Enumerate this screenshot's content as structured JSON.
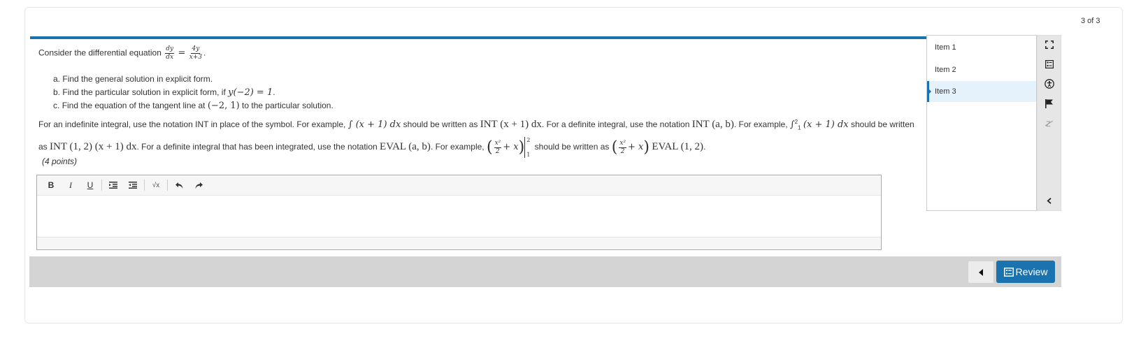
{
  "header": {
    "counter": "3 of 3"
  },
  "question": {
    "intro_text": "Consider the differential equation",
    "equation": {
      "lhs_num": "dy",
      "lhs_den": "dx",
      "eq": "=",
      "rhs_num": "4y",
      "rhs_den": "x+3",
      "end": "."
    },
    "parts": [
      {
        "label": "a.",
        "text": "Find the general solution in explicit form.",
        "math": "",
        "after": ""
      },
      {
        "label": "b.",
        "text": "Find the particular solution in explicit form, if",
        "math": "y(−2) = 1",
        "after": "."
      },
      {
        "label": "c.",
        "text": "Find the equation of the tangent line at",
        "math": "(−2, 1)",
        "after": "to the particular solution."
      }
    ],
    "notation_line1": {
      "t1": "For an indefinite integral, use the notation INT in place of the symbol. For example,",
      "m1": "∫ (x + 1) dx",
      "t2": "should be written as",
      "m2": "INT (x + 1) dx",
      "t3": ". For a definite integral, use the notation",
      "m3": "INT (a, b)",
      "t4": ". For example,",
      "m4_int": "∫",
      "m4_upper": "2",
      "m4_lower": "1",
      "m4_rest": "(x + 1) dx",
      "t5": "should be written"
    },
    "notation_line2": {
      "t1": "as",
      "m1": "INT (1, 2) (x + 1) dx",
      "t2": ". For a definite integral that has been integrated, use the notation",
      "m2": "EVAL (a, b)",
      "t3": ". For example,",
      "frac_num": "x²",
      "frac_den": "2",
      "plus_x": "+ x",
      "upper": "2",
      "lower": "1",
      "t4": "should be written as",
      "m5": "EVAL (1, 2)",
      "end": "."
    },
    "points": "(4 points)"
  },
  "editor": {
    "toolbar": {
      "bold": "B",
      "italic": "I",
      "underline": "U",
      "indent": "indent-icon",
      "outdent": "outdent-icon",
      "math": "√x",
      "undo": "undo-icon",
      "redo": "redo-icon"
    },
    "value": ""
  },
  "items": [
    {
      "label": "Item 1",
      "active": false
    },
    {
      "label": "Item 2",
      "active": false
    },
    {
      "label": "Item 3",
      "active": true
    }
  ],
  "tools": [
    "fullscreen-icon",
    "item-list-icon",
    "accessibility-icon",
    "flag-icon",
    "strikethrough-icon",
    "collapse-icon"
  ],
  "footer": {
    "review_label": "Review"
  },
  "colors": {
    "accent": "#1a73ae",
    "footer_bg": "#d4d4d4",
    "active_item_bg": "#e5f1fb"
  }
}
